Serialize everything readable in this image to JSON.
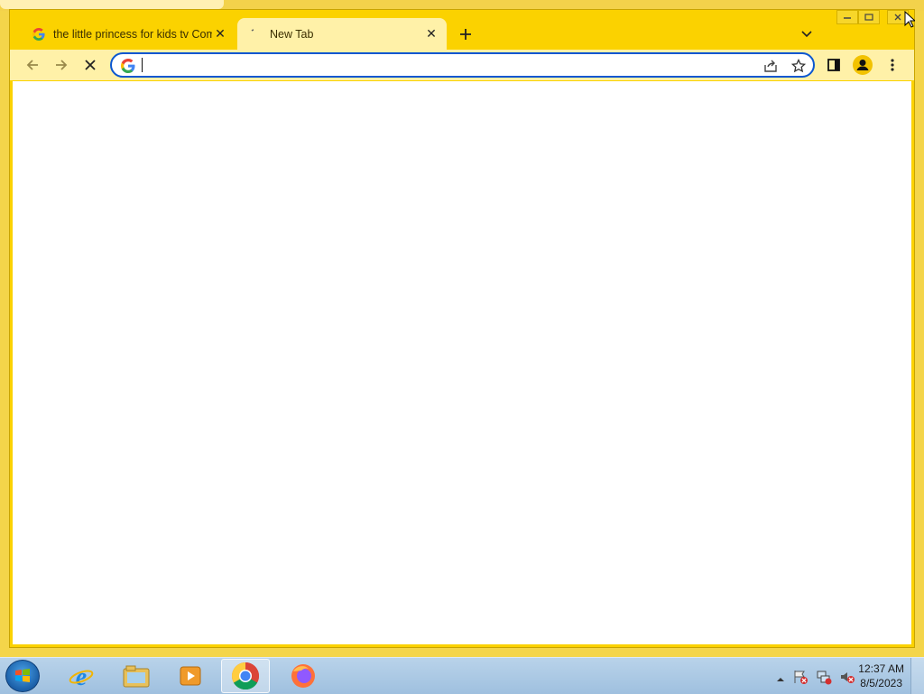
{
  "browser": {
    "tabs": [
      {
        "title": "the little princess for kids tv Com",
        "favicon": "google-g-icon",
        "active": false
      },
      {
        "title": "New Tab",
        "favicon": "loading-icon",
        "active": true
      }
    ],
    "omnibox": {
      "value": "",
      "placeholder": ""
    },
    "colors": {
      "frame": "#fbd200",
      "toolbar": "#fff1a8",
      "focus_ring": "#0b57d0"
    }
  },
  "taskbar": {
    "apps": [
      "internet-explorer-icon",
      "windows-explorer-icon",
      "media-player-icon",
      "chrome-icon",
      "firefox-icon"
    ],
    "clock": {
      "time": "12:37 AM",
      "date": "8/5/2023"
    }
  }
}
